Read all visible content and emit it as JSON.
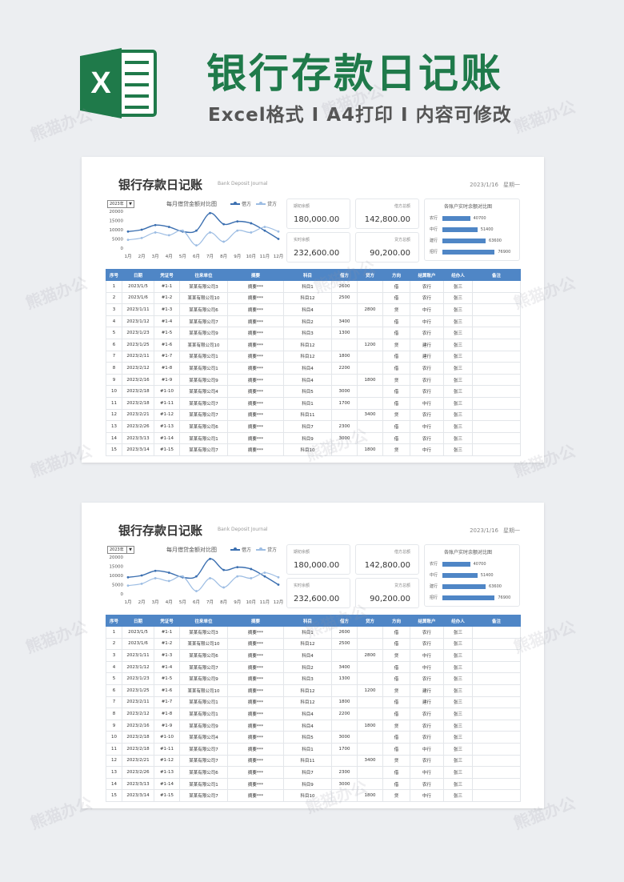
{
  "header": {
    "title": "银行存款日记账",
    "subtitle": "Excel格式 I A4打印 I 内容可修改",
    "logo_letter": "X"
  },
  "document": {
    "title": "银行存款日记账",
    "title_en": "Bank Deposit Journal",
    "date": "2023/1/16",
    "weekday": "星期一",
    "year_selector": "2023年"
  },
  "chart_data": {
    "type": "line",
    "title": "每月借贷金额对比图",
    "categories": [
      "1月",
      "2月",
      "3月",
      "4月",
      "5月",
      "6月",
      "7月",
      "8月",
      "9月",
      "10月",
      "11月",
      "12月"
    ],
    "y_ticks": [
      "20000",
      "15000",
      "10000",
      "5000",
      "0"
    ],
    "ylim": [
      0,
      20000
    ],
    "series": [
      {
        "name": "借方",
        "values": [
          9000,
          10000,
          12500,
          11500,
          9000,
          9500,
          19000,
          13000,
          14500,
          13500,
          9500,
          5000
        ]
      },
      {
        "name": "贷方",
        "values": [
          4500,
          5500,
          8500,
          7000,
          9500,
          1500,
          8500,
          3500,
          9500,
          8500,
          11500,
          9000
        ]
      }
    ],
    "colors": [
      "#3b6fb0",
      "#9dbde3"
    ],
    "legend": "top-right",
    "grid": false
  },
  "stats": {
    "opening_label": "期初余额",
    "opening_value": "180,000.00",
    "debit_label": "借方总额",
    "debit_value": "142,800.00",
    "current_label": "实时余额",
    "current_value": "232,600.00",
    "credit_label": "贷方总额",
    "credit_value": "90,200.00"
  },
  "accounts": {
    "title": "各账户实时余额对比图",
    "max": 80000,
    "items": [
      {
        "name": "农行",
        "value": 40700,
        "label": "40700"
      },
      {
        "name": "中行",
        "value": 51400,
        "label": "51400"
      },
      {
        "name": "建行",
        "value": 63600,
        "label": "63600"
      },
      {
        "name": "招行",
        "value": 76900,
        "label": "76900"
      }
    ]
  },
  "table": {
    "headers": [
      "序号",
      "日期",
      "凭证号",
      "往来单位",
      "摘要",
      "科目",
      "借方",
      "贷方",
      "方向",
      "结算账户",
      "经办人",
      "备注"
    ],
    "rows": [
      [
        "1",
        "2023/1/5",
        "#1-1",
        "某某有限公司3",
        "摘要***",
        "科目1",
        "2600",
        "",
        "借",
        "农行",
        "张三",
        ""
      ],
      [
        "2",
        "2023/1/6",
        "#1-2",
        "某某有限公司10",
        "摘要***",
        "科目12",
        "2500",
        "",
        "借",
        "农行",
        "张三",
        ""
      ],
      [
        "3",
        "2023/1/11",
        "#1-3",
        "某某有限公司6",
        "摘要***",
        "科目4",
        "",
        "2800",
        "贷",
        "中行",
        "张三",
        ""
      ],
      [
        "4",
        "2023/1/12",
        "#1-4",
        "某某有限公司7",
        "摘要***",
        "科目2",
        "3400",
        "",
        "借",
        "中行",
        "张三",
        ""
      ],
      [
        "5",
        "2023/1/23",
        "#1-5",
        "某某有限公司9",
        "摘要***",
        "科目3",
        "1300",
        "",
        "借",
        "农行",
        "张三",
        ""
      ],
      [
        "6",
        "2023/1/25",
        "#1-6",
        "某某有限公司10",
        "摘要***",
        "科目12",
        "",
        "1200",
        "贷",
        "建行",
        "张三",
        ""
      ],
      [
        "7",
        "2023/2/11",
        "#1-7",
        "某某有限公司1",
        "摘要***",
        "科目12",
        "1800",
        "",
        "借",
        "建行",
        "张三",
        ""
      ],
      [
        "8",
        "2023/2/12",
        "#1-8",
        "某某有限公司1",
        "摘要***",
        "科目4",
        "2200",
        "",
        "借",
        "农行",
        "张三",
        ""
      ],
      [
        "9",
        "2023/2/16",
        "#1-9",
        "某某有限公司9",
        "摘要***",
        "科目4",
        "",
        "1800",
        "贷",
        "农行",
        "张三",
        ""
      ],
      [
        "10",
        "2023/2/18",
        "#1-10",
        "某某有限公司4",
        "摘要***",
        "科目5",
        "3000",
        "",
        "借",
        "农行",
        "张三",
        ""
      ],
      [
        "11",
        "2023/2/18",
        "#1-11",
        "某某有限公司7",
        "摘要***",
        "科目1",
        "1700",
        "",
        "借",
        "中行",
        "张三",
        ""
      ],
      [
        "12",
        "2023/2/21",
        "#1-12",
        "某某有限公司7",
        "摘要***",
        "科目11",
        "",
        "3400",
        "贷",
        "农行",
        "张三",
        ""
      ],
      [
        "13",
        "2023/2/26",
        "#1-13",
        "某某有限公司6",
        "摘要***",
        "科目7",
        "2300",
        "",
        "借",
        "中行",
        "张三",
        ""
      ],
      [
        "14",
        "2023/3/13",
        "#1-14",
        "某某有限公司1",
        "摘要***",
        "科目9",
        "3000",
        "",
        "借",
        "农行",
        "张三",
        ""
      ],
      [
        "15",
        "2023/3/14",
        "#1-15",
        "某某有限公司7",
        "摘要***",
        "科目10",
        "",
        "1800",
        "贷",
        "中行",
        "张三",
        ""
      ]
    ]
  },
  "watermark": "熊猫办公"
}
